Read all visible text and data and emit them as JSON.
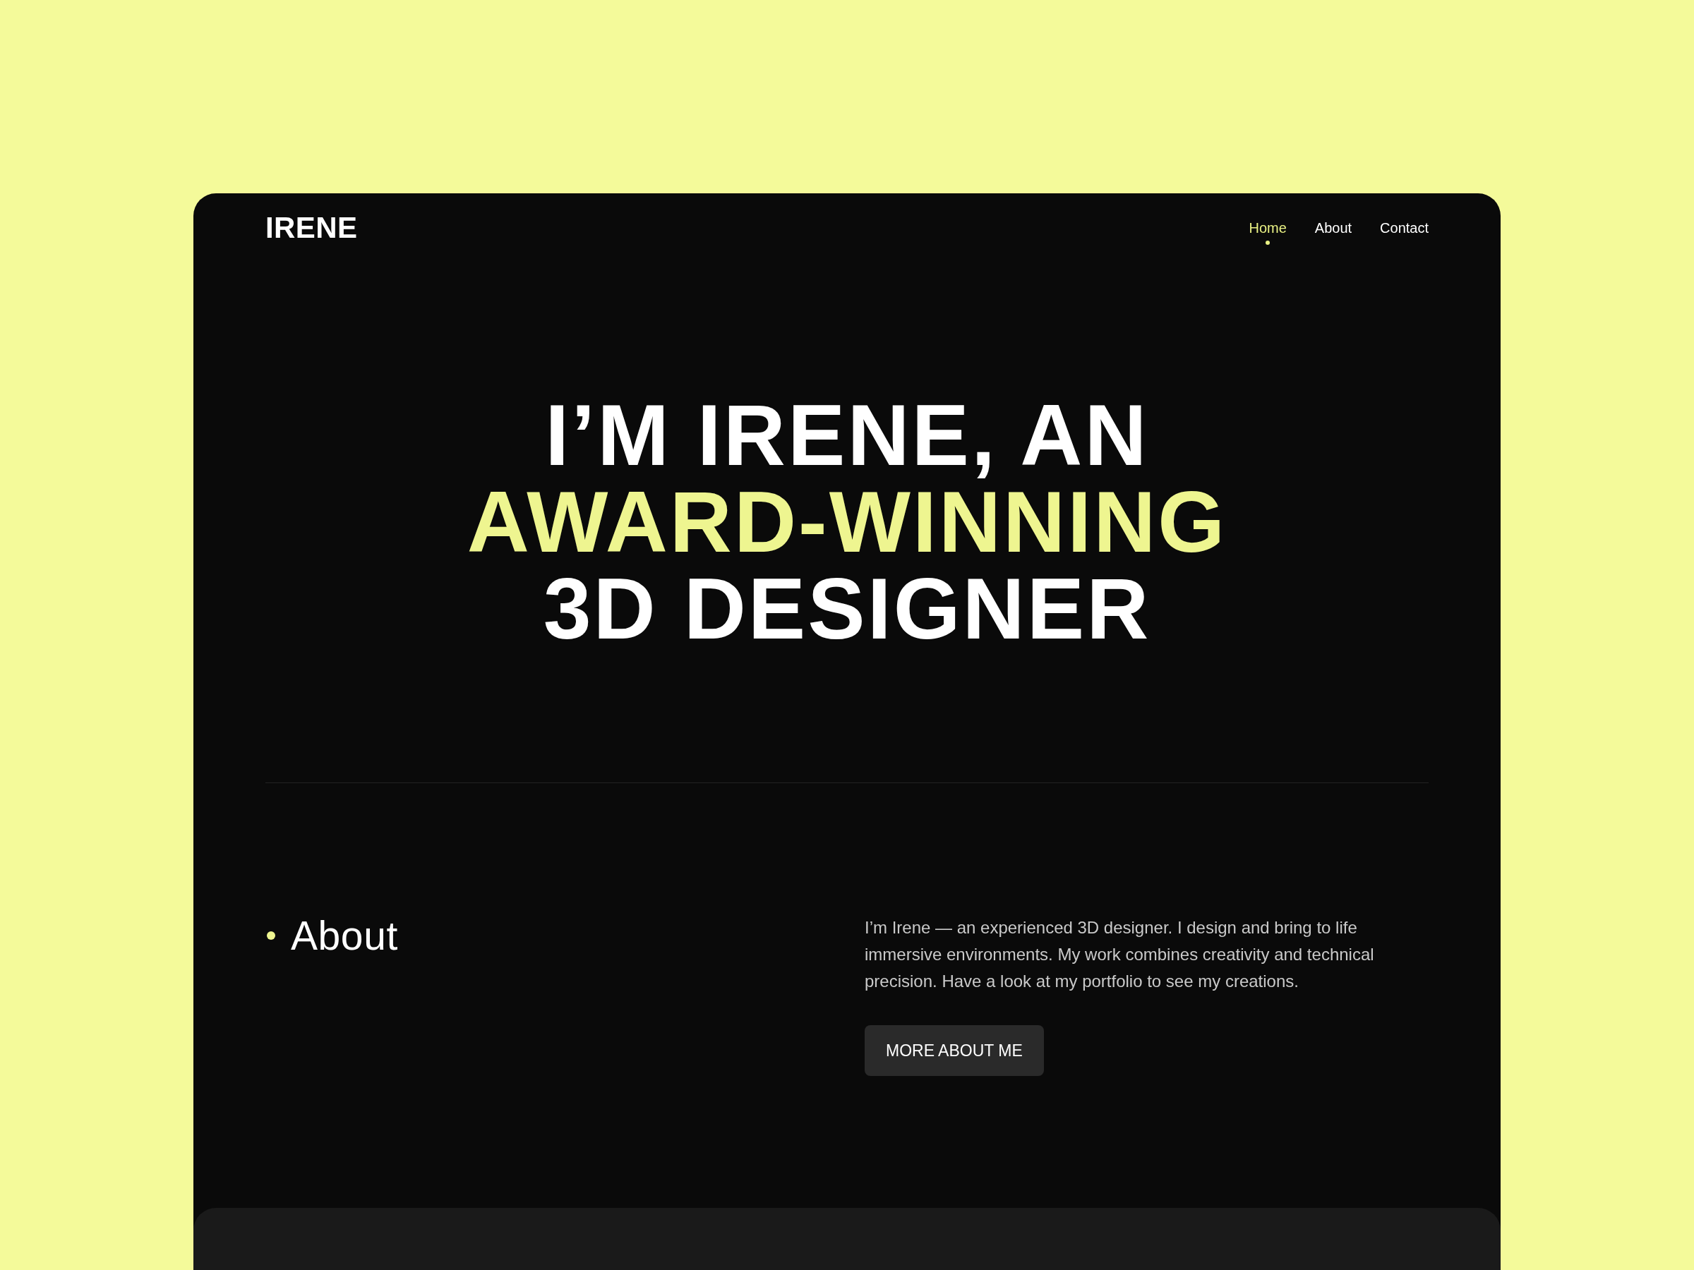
{
  "header": {
    "logo": "IRENE",
    "nav": [
      {
        "label": "Home",
        "selected": true
      },
      {
        "label": "About",
        "selected": false
      },
      {
        "label": "Contact",
        "selected": false
      }
    ]
  },
  "hero": {
    "headline": [
      {
        "text": "I’M IRENE, AN",
        "highlighted": false
      },
      {
        "text": "AWARD-WINNING",
        "highlighted": true
      },
      {
        "text": "3D DESIGNER",
        "highlighted": false
      }
    ]
  },
  "about": {
    "heading": "About",
    "body": "I’m Irene — an experienced 3D designer. I design and bring to life immersive environments. My work combines creativity and technical precision. Have a look at my portfolio to see my creations.",
    "button": "MORE ABOUT ME"
  }
}
